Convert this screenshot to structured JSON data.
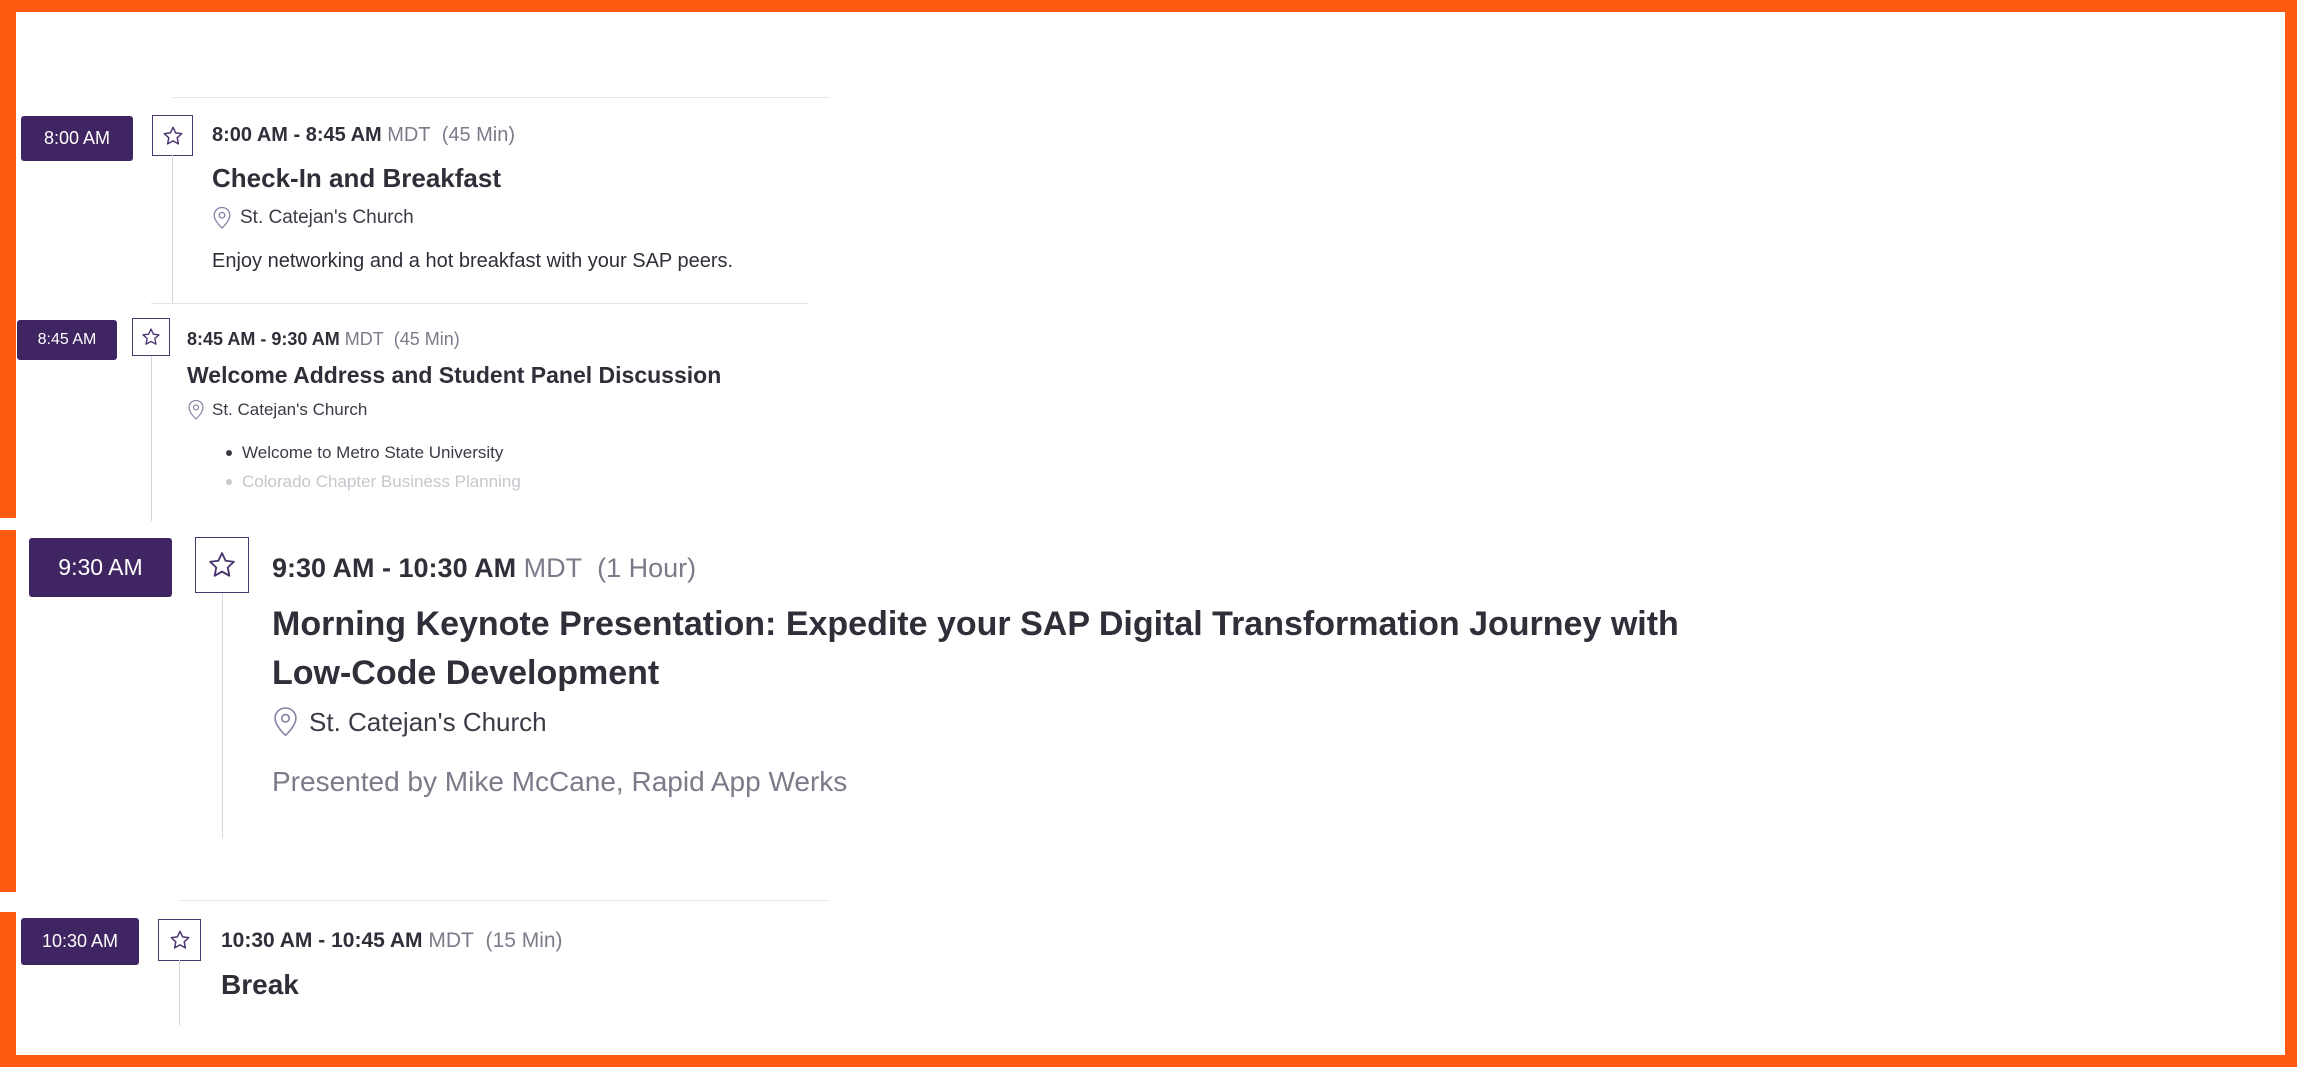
{
  "sessions": [
    {
      "badge": "8:00 AM",
      "time_range": "8:00 AM - 8:45 AM",
      "timezone": "MDT",
      "duration": "(45 Min)",
      "title": "Check-In and Breakfast",
      "location": "St. Catejan's Church",
      "description": "Enjoy networking and a hot breakfast with your SAP peers."
    },
    {
      "badge": "8:45 AM",
      "time_range": "8:45 AM - 9:30 AM",
      "timezone": "MDT",
      "duration": "(45 Min)",
      "title": "Welcome Address and Student Panel Discussion",
      "location": "St. Catejan's Church",
      "bullets": [
        "Welcome to Metro State University",
        "Colorado Chapter Business Planning"
      ]
    },
    {
      "badge": "9:30 AM",
      "time_range": "9:30 AM - 10:30 AM",
      "timezone": "MDT",
      "duration": "(1 Hour)",
      "title_line1": "Morning Keynote Presentation: Expedite your SAP Digital Transformation Journey with",
      "title_line2": "Low-Code Development",
      "location": "St. Catejan's Church",
      "description": "Presented by Mike McCane, Rapid App Werks"
    },
    {
      "badge": "10:30 AM",
      "time_range": "10:30 AM - 10:45 AM",
      "timezone": "MDT",
      "duration": "(15 Min)",
      "title": "Break"
    }
  ],
  "icons": {
    "favorite": "star-icon",
    "location": "map-pin-icon"
  },
  "colors": {
    "badge_bg": "#3f2562",
    "frame_border": "#ff5a12",
    "muted_text": "#7b7b8a"
  }
}
